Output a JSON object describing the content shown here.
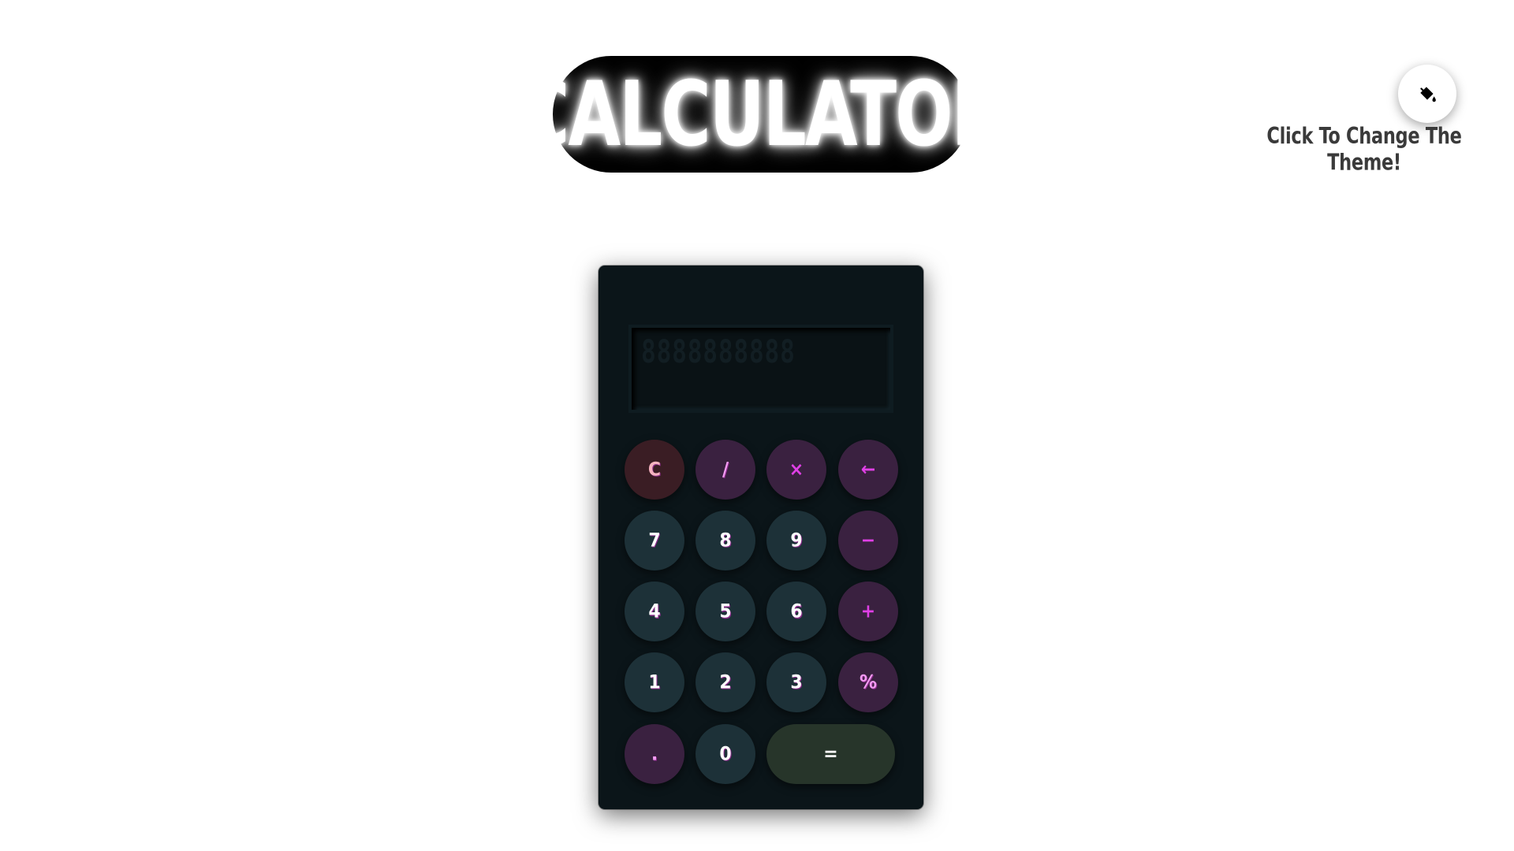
{
  "title": "CALCULATOR",
  "theme": {
    "button_icon": "paint-bucket-icon",
    "label": "Click To Change The Theme!"
  },
  "display": {
    "ghost": "8888888888",
    "value": ""
  },
  "keys": {
    "clear": "C",
    "divide": "/",
    "multiply": "×",
    "backspace": "←",
    "seven": "7",
    "eight": "8",
    "nine": "9",
    "minus": "−",
    "four": "4",
    "five": "5",
    "six": "6",
    "plus": "+",
    "one": "1",
    "two": "2",
    "three": "3",
    "percent": "%",
    "dot": ".",
    "zero": "0",
    "equals": "="
  },
  "colors": {
    "calculator_body": "#0b1519",
    "number_key": "#1d3138",
    "operator_key": "#3a2140",
    "operator_text": "#e040e6",
    "clear_key": "#3a1d24",
    "equals_key": "#27352a"
  }
}
